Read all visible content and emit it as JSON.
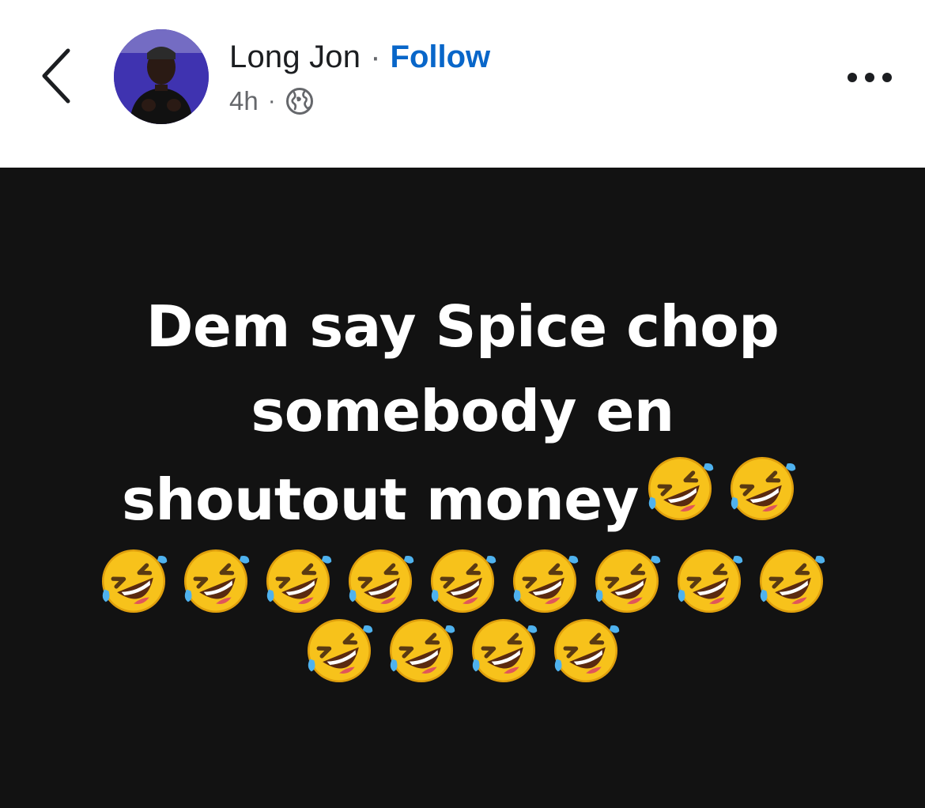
{
  "header": {
    "author_name": "Long Jon",
    "separator": "·",
    "follow_label": "Follow",
    "time": "4h",
    "meta_separator": "·",
    "audience_icon": "globe-icon",
    "back_icon": "chevron-left-icon",
    "more_icon": "more-horizontal-icon"
  },
  "post": {
    "background_color": "#121212",
    "text_color": "#ffffff",
    "line1": "Dem say Spice chop",
    "line2": "somebody en",
    "line3": "shoutout money",
    "emoji_name": "rolling-on-floor-laughing-emoji",
    "emoji_count_line3": 2,
    "emoji_count_line4": 9,
    "emoji_count_line5": 4
  },
  "colors": {
    "follow_blue": "#0866c9",
    "meta_gray": "#65676b",
    "name_black": "#1c1e21"
  }
}
